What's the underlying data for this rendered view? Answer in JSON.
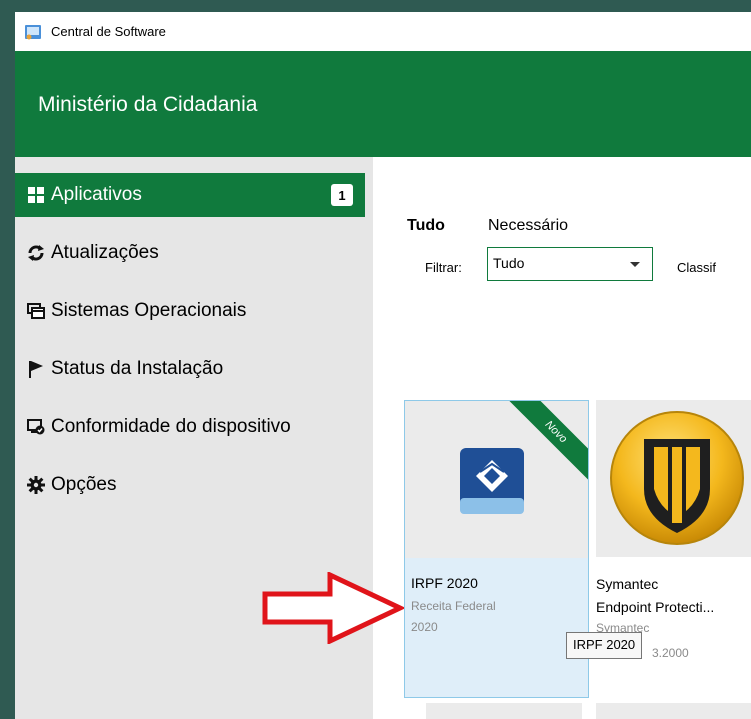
{
  "window": {
    "title": "Central de Software",
    "organization": "Ministério da Cidadania"
  },
  "sidebar": {
    "items": [
      {
        "label": "Aplicativos",
        "icon": "apps-grid-icon",
        "badge": "1",
        "active": true
      },
      {
        "label": "Atualizações",
        "icon": "refresh-icon"
      },
      {
        "label": "Sistemas Operacionais",
        "icon": "windows-stack-icon"
      },
      {
        "label": "Status da Instalação",
        "icon": "flag-icon"
      },
      {
        "label": "Conformidade do dispositivo",
        "icon": "device-compliance-icon"
      },
      {
        "label": "Opções",
        "icon": "gear-icon"
      }
    ]
  },
  "main": {
    "tabs": [
      {
        "label": "Tudo",
        "selected": true
      },
      {
        "label": "Necessário"
      }
    ],
    "filter_label": "Filtrar:",
    "filter_value": "Tudo",
    "sort_label": "Classif"
  },
  "apps": [
    {
      "name": "IRPF 2020",
      "publisher": "Receita Federal",
      "version": "2020",
      "ribbon": "Novo"
    },
    {
      "name_line1": "Symantec",
      "name_line2": "Endpoint Protecti...",
      "publisher": "Symantec",
      "version_fragment": "3.2000"
    }
  ],
  "tooltip": "IRPF 2020",
  "colors": {
    "accent": "#107a3d",
    "sidebar": "#e6e6e6",
    "selected_card": "#dfeef9",
    "annotation_arrow": "#e0141a"
  }
}
